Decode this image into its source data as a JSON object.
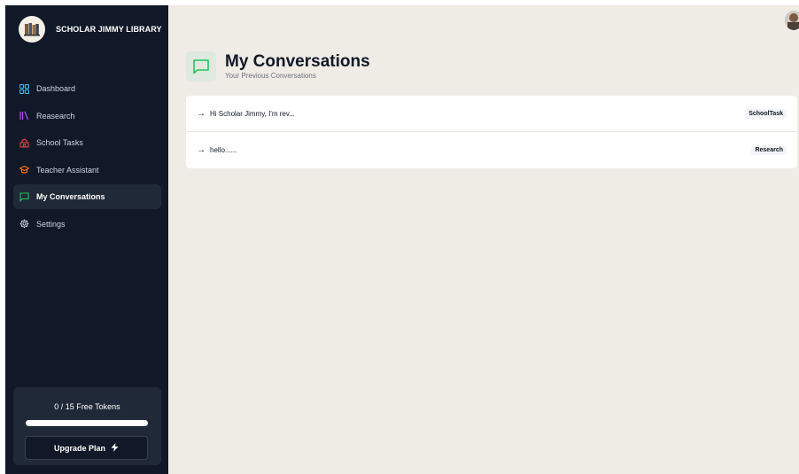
{
  "brand": {
    "title": "SCHOLAR JIMMY LIBRARY",
    "logo_icon": "books-icon"
  },
  "sidebar": {
    "items": [
      {
        "label": "Dashboard",
        "icon": "grid-icon",
        "color": "#38bdf8"
      },
      {
        "label": "Reasearch",
        "icon": "library-icon",
        "color": "#a855f7"
      },
      {
        "label": "School Tasks",
        "icon": "school-icon",
        "color": "#ef4444"
      },
      {
        "label": "Teacher Assistant",
        "icon": "graduation-cap-icon",
        "color": "#f97316"
      },
      {
        "label": "My Conversations",
        "icon": "message-icon",
        "color": "#22c55e",
        "active": true
      },
      {
        "label": "Settings",
        "icon": "gear-icon",
        "color": "#cbd5e1"
      }
    ]
  },
  "tokens": {
    "text": "0 / 15 Free Tokens",
    "used": 0,
    "total": 15,
    "upgrade_label": "Upgrade Plan",
    "upgrade_icon": "lightning-icon"
  },
  "page": {
    "title": "My Conversations",
    "subtitle": "Your Previous Conversations",
    "icon": "message-icon",
    "accent": "#22c55e"
  },
  "conversations": [
    {
      "arrow": "→",
      "text": "Hi Scholar Jimmy, I'm rev...",
      "tag": "SchoolTask"
    },
    {
      "arrow": "→",
      "text": "hello......",
      "tag": "Research"
    }
  ],
  "user": {
    "avatar_icon": "user-avatar"
  }
}
